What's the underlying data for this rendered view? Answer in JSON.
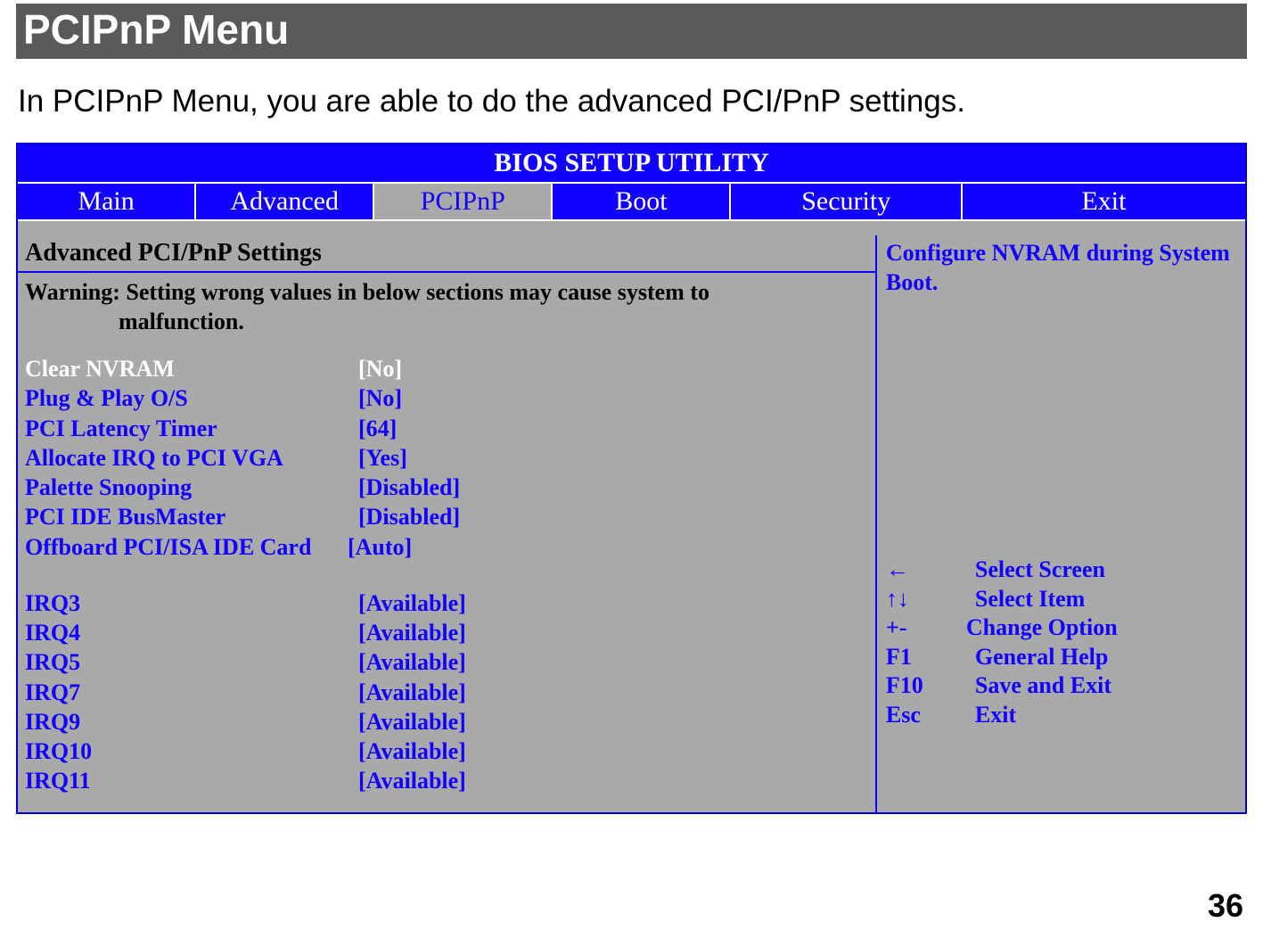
{
  "heading": "PCIPnP Menu",
  "intro": "In PCIPnP Menu, you are able to do the advanced PCI/PnP settings.",
  "bios_title": "BIOS SETUP UTILITY",
  "tabs": {
    "main": "Main",
    "advanced": "Advanced",
    "pcipnp": "PCIPnP",
    "boot": "Boot",
    "security": "Security",
    "exit": "Exit"
  },
  "panel_heading": "Advanced PCI/PnP Settings",
  "warning_line1": "Warning: Setting wrong values in below sections may cause system to",
  "warning_line2": "malfunction.",
  "settings": {
    "clear_nvram": {
      "label": "Clear NVRAM",
      "value": "[No]"
    },
    "plug_play": {
      "label": "Plug & Play O/S",
      "value": "[No]"
    },
    "pci_latency": {
      "label": "PCI Latency Timer",
      "value": "[64]"
    },
    "allocate_irq": {
      "label": "Allocate IRQ to PCI VGA",
      "value": "[Yes]"
    },
    "palette_snooping": {
      "label": "Palette Snooping",
      "value": "[Disabled]"
    },
    "pci_ide_busmaster": {
      "label": "PCI IDE BusMaster",
      "value": "[Disabled]"
    },
    "offboard": {
      "label": "Offboard PCI/ISA IDE Card",
      "value": "[Auto]"
    },
    "irq3": {
      "label": "IRQ3",
      "value": "[Available]"
    },
    "irq4": {
      "label": "IRQ4",
      "value": "[Available]"
    },
    "irq5": {
      "label": "IRQ5",
      "value": "[Available]"
    },
    "irq7": {
      "label": "IRQ7",
      "value": "[Available]"
    },
    "irq9": {
      "label": "IRQ9",
      "value": "[Available]"
    },
    "irq10": {
      "label": "IRQ10",
      "value": "[Available]"
    },
    "irq11": {
      "label": "IRQ11",
      "value": "[Available]"
    }
  },
  "help_text": "Configure NVRAM during System Boot.",
  "keys": {
    "select_screen": {
      "key": "←",
      "action": "Select Screen"
    },
    "select_item": {
      "key": "↑↓",
      "action": "Select Item"
    },
    "change_option": {
      "key": "+-",
      "action": "Change Option"
    },
    "general_help": {
      "key": "F1",
      "action": "General Help"
    },
    "save_exit": {
      "key": "F10",
      "action": "Save and Exit"
    },
    "exit": {
      "key": "Esc",
      "action": "Exit"
    }
  },
  "page_number": "36"
}
